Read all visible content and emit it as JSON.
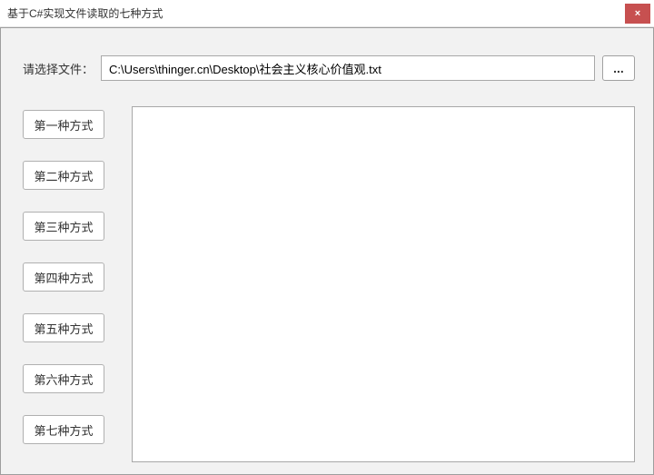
{
  "window": {
    "title": "基于C#实现文件读取的七种方式",
    "close_label": "×"
  },
  "file_select": {
    "label": "请选择文件：",
    "path": "C:\\Users\\thinger.cn\\Desktop\\社会主义核心价值观.txt",
    "browse_label": "..."
  },
  "methods": [
    {
      "label": "第一种方式"
    },
    {
      "label": "第二种方式"
    },
    {
      "label": "第三种方式"
    },
    {
      "label": "第四种方式"
    },
    {
      "label": "第五种方式"
    },
    {
      "label": "第六种方式"
    },
    {
      "label": "第七种方式"
    }
  ],
  "output": {
    "value": ""
  }
}
